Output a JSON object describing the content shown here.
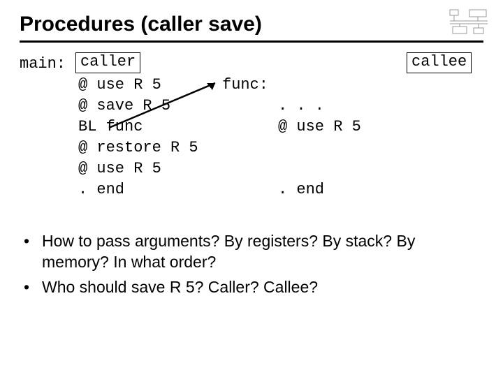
{
  "title": "Procedures (caller save)",
  "main_label": "main:",
  "caller_box": "caller",
  "main_lines": {
    "l1": "@ use R 5",
    "l2": "@ save R 5",
    "l3": "BL func",
    "l4": "@ restore R 5",
    "l5": "@ use R 5",
    "l6": ". end"
  },
  "callee_box": "callee",
  "func_label": "func:",
  "func_lines": {
    "l1": ". . .",
    "l2": "@ use R 5",
    "l3": ". end"
  },
  "bullets": {
    "b1": "How to pass arguments? By registers? By stack? By memory? In what order?",
    "b2": "Who should save R 5? Caller? Callee?"
  }
}
